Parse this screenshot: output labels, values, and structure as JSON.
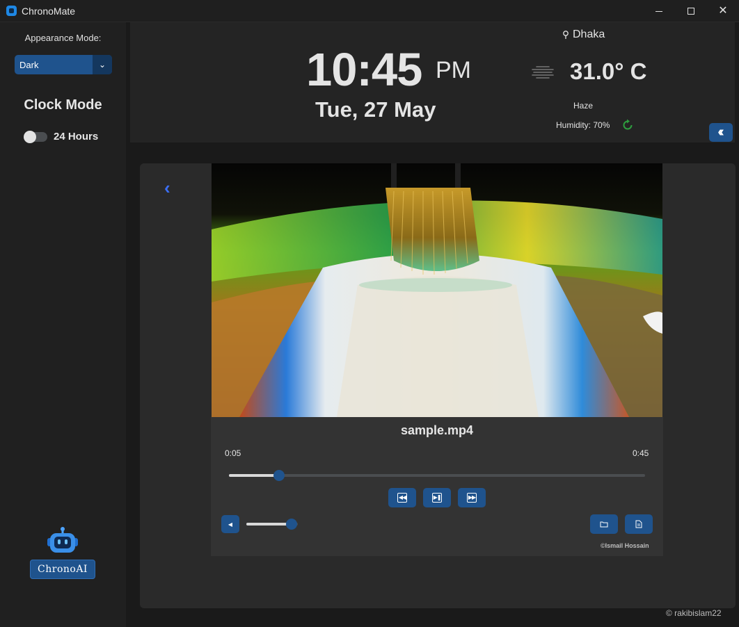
{
  "window": {
    "title": "ChronoMate"
  },
  "sidebar": {
    "appearance_label": "Appearance Mode:",
    "appearance_value": "Dark",
    "clock_mode_title": "Clock Mode",
    "toggle_label": "24 Hours",
    "toggle_on": false,
    "ai_button_label": "ChronoAI"
  },
  "clock": {
    "time": "10:45",
    "ampm": "PM",
    "date": "Tue, 27 May"
  },
  "weather": {
    "location": "Dhaka",
    "temperature": "31.0° C",
    "condition": "Haze",
    "humidity": "Humidity: 70%"
  },
  "player": {
    "file_name": "sample.mp4",
    "current_time": "0:05",
    "total_time": "0:45",
    "progress": 0.12,
    "volume": 0.88,
    "credit": "©Ismail Hossain"
  },
  "footer": {
    "copyright": "© rakibislam22"
  },
  "colors": {
    "accent": "#1f538d",
    "back_arrow": "#3b6ff5",
    "refresh": "#2e9e3f"
  },
  "icons": {
    "location": "location-pin-icon",
    "weather": "haze-icon",
    "refresh": "refresh-icon",
    "collapse": "double-chevron-left-icon",
    "back": "chevron-left-icon",
    "rewind": "skip-backward-icon",
    "play_pause": "play-pause-icon",
    "forward": "skip-forward-icon",
    "volume": "volume-icon",
    "open_folder": "folder-open-icon",
    "document": "document-icon",
    "robot": "robot-icon"
  }
}
